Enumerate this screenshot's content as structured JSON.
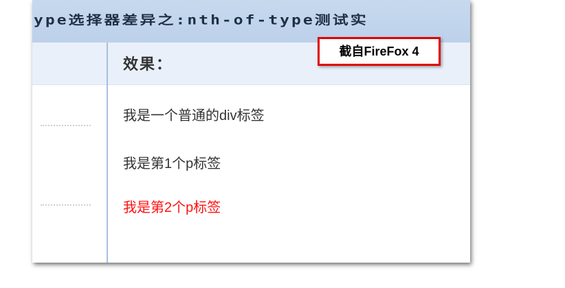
{
  "title": "ype选择器差异之:nth-of-type测试实",
  "result_header": "效果：",
  "badge_text": "截自FireFox 4",
  "lines": [
    {
      "text": "我是一个普通的div标签",
      "color": "#333333"
    },
    {
      "text": "我是第1个p标签",
      "color": "#333333"
    },
    {
      "text": "我是第2个p标签",
      "color": "#ff1111"
    }
  ],
  "colors": {
    "title_bar": "#c6d9ef",
    "header_row": "#e9f0f9",
    "divider": "#a9bfe2",
    "highlight_text": "#ff1111",
    "badge_border": "#e00000"
  }
}
